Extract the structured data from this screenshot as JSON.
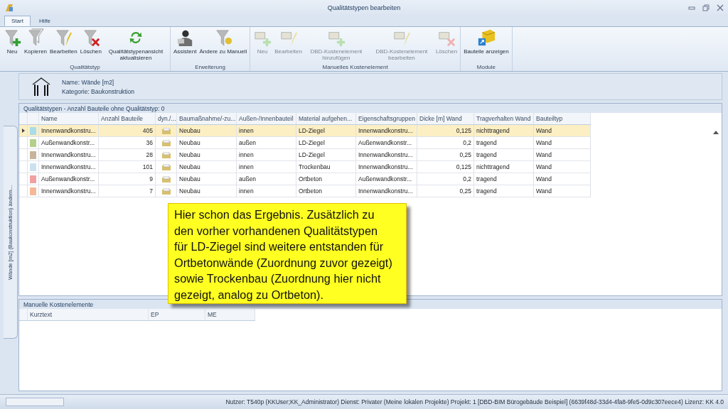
{
  "window": {
    "title": "Qualitätstypen bearbeiten"
  },
  "tabs": [
    {
      "label": "Start",
      "selected": true
    },
    {
      "label": "Hilfe",
      "selected": false
    }
  ],
  "ribbon_groups": [
    {
      "label": "Qualitätstyp",
      "buttons": [
        {
          "label": "Neu",
          "disabled": false
        },
        {
          "label": "Kopieren",
          "disabled": false
        },
        {
          "label": "Bearbeiten",
          "disabled": false
        },
        {
          "label": "Löschen",
          "disabled": false
        },
        {
          "label": "Qualitätstypenansicht aktualisieren",
          "disabled": false
        }
      ]
    },
    {
      "label": "Erweiterung",
      "buttons": [
        {
          "label": "Assistent",
          "disabled": false
        },
        {
          "label": "Ändere zu Manuell",
          "disabled": false
        }
      ]
    },
    {
      "label": "Manuelles Kostenelement",
      "buttons": [
        {
          "label": "Neu",
          "disabled": true
        },
        {
          "label": "Bearbeiten",
          "disabled": true
        },
        {
          "label": "DBD-Kostenelement hinzufügen",
          "disabled": true
        },
        {
          "label": "DBD-Kostenelement bearbeiten",
          "disabled": true
        },
        {
          "label": "Löschen",
          "disabled": true
        }
      ]
    },
    {
      "label": "Module",
      "buttons": [
        {
          "label": "Bauteile anzeigen",
          "disabled": false
        }
      ]
    }
  ],
  "info": {
    "name": "Name: Wände [m2]",
    "category": "Kategorie: Baukonstruktion"
  },
  "side_tab": {
    "label": "Wände [m2] (Baukonstruktion) ändern..."
  },
  "quality_table": {
    "title": "Qualitätstypen - Anzahl Bauteile ohne Qualitätstyp: 0",
    "columns": [
      "Name",
      "Anzahl Bauteile",
      "dyn./...",
      "Baumaßnahme/-zu...",
      "Außen-/Innenbauteil",
      "Material aufgehen...",
      "Eigenschaftsgruppen",
      "Dicke [m] Wand",
      "Tragverhalten Wand",
      "Bauteiltyp"
    ],
    "rows": [
      {
        "selected": true,
        "color": "#a8dce8",
        "cells": [
          "Innenwandkonstru...",
          "405",
          "",
          "Neubau",
          "innen",
          "LD-Ziegel",
          "Innenwandkonstru...",
          "0,125",
          "nichttragend",
          "Wand"
        ]
      },
      {
        "selected": false,
        "color": "#b4d08c",
        "cells": [
          "Außenwandkonstr...",
          "36",
          "",
          "Neubau",
          "außen",
          "LD-Ziegel",
          "Außenwandkonstr...",
          "0,2",
          "tragend",
          "Wand"
        ]
      },
      {
        "selected": false,
        "color": "#c8b49c",
        "cells": [
          "Innenwandkonstru...",
          "28",
          "",
          "Neubau",
          "innen",
          "LD-Ziegel",
          "Innenwandkonstru...",
          "0,25",
          "tragend",
          "Wand"
        ]
      },
      {
        "selected": false,
        "color": "#cce0f0",
        "cells": [
          "Innenwandkonstru...",
          "101",
          "",
          "Neubau",
          "innen",
          "Trockenbau",
          "Innenwandkonstru...",
          "0,125",
          "nichttragend",
          "Wand"
        ]
      },
      {
        "selected": false,
        "color": "#f0a0a0",
        "cells": [
          "Außenwandkonstr...",
          "9",
          "",
          "Neubau",
          "außen",
          "Ortbeton",
          "Außenwandkonstr...",
          "0,2",
          "tragend",
          "Wand"
        ]
      },
      {
        "selected": false,
        "color": "#f4b898",
        "cells": [
          "Innenwandkonstru...",
          "7",
          "",
          "Neubau",
          "innen",
          "Ortbeton",
          "Innenwandkonstru...",
          "0,25",
          "tragend",
          "Wand"
        ]
      }
    ]
  },
  "cost_table": {
    "title": "Manuelle Kostenelemente",
    "columns": [
      "Kurztext",
      "EP",
      "ME"
    ]
  },
  "callout": {
    "text": "Hier schon das Ergebnis. Zusätzlich zu den vorher vorhandenen Qualitätstypen für LD-Ziegel sind weitere entstanden für Ortbetonwände (Zuordnung zuvor gezeigt) sowie Trockenbau (Zuordnung hier nicht gezeigt, analog zu Ortbeton)."
  },
  "status_bar": {
    "progress": {
      "level": 0
    },
    "text": "Nutzer: T540p (KKUser;KK_Administrator)  Dienst: Privater (Meine lokalen Projekte)  Projekt: 1 [DBD-BIM Bürogebäude Beispiel] (6639f48d-33d4-4fa8-9fe5-0d9c307eece4)  Lizenz: KK 4.0"
  }
}
